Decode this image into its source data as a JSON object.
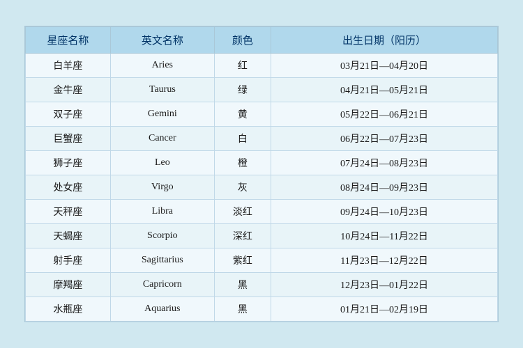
{
  "table": {
    "headers": [
      {
        "label": "星座名称",
        "key": "chinese"
      },
      {
        "label": "英文名称",
        "key": "english"
      },
      {
        "label": "颜色",
        "key": "color"
      },
      {
        "label": "出生日期（阳历）",
        "key": "date"
      }
    ],
    "rows": [
      {
        "chinese": "白羊座",
        "english": "Aries",
        "color": "红",
        "date": "03月21日—04月20日"
      },
      {
        "chinese": "金牛座",
        "english": "Taurus",
        "color": "绿",
        "date": "04月21日—05月21日"
      },
      {
        "chinese": "双子座",
        "english": "Gemini",
        "color": "黄",
        "date": "05月22日—06月21日"
      },
      {
        "chinese": "巨蟹座",
        "english": "Cancer",
        "color": "白",
        "date": "06月22日—07月23日"
      },
      {
        "chinese": "狮子座",
        "english": "Leo",
        "color": "橙",
        "date": "07月24日—08月23日"
      },
      {
        "chinese": "处女座",
        "english": "Virgo",
        "color": "灰",
        "date": "08月24日—09月23日"
      },
      {
        "chinese": "天秤座",
        "english": "Libra",
        "color": "淡红",
        "date": "09月24日—10月23日"
      },
      {
        "chinese": "天蝎座",
        "english": "Scorpio",
        "color": "深红",
        "date": "10月24日—11月22日"
      },
      {
        "chinese": "射手座",
        "english": "Sagittarius",
        "color": "紫红",
        "date": "11月23日—12月22日"
      },
      {
        "chinese": "摩羯座",
        "english": "Capricorn",
        "color": "黑",
        "date": "12月23日—01月22日"
      },
      {
        "chinese": "水瓶座",
        "english": "Aquarius",
        "color": "黑",
        "date": "01月21日—02月19日"
      }
    ]
  }
}
